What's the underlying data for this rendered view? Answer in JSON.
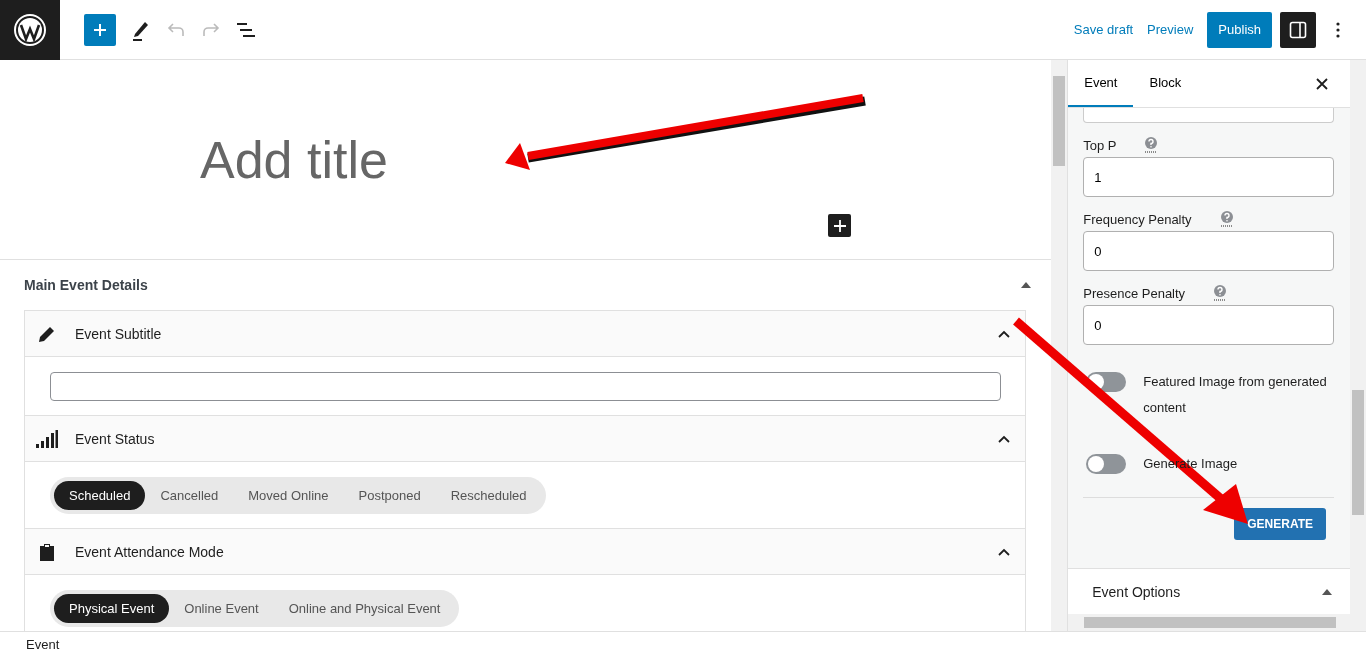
{
  "header": {
    "inserter_open": false,
    "undo_disabled": true,
    "redo_disabled": true,
    "actions": [
      {
        "label": "Save draft",
        "kind": "link"
      },
      {
        "label": "Preview",
        "kind": "link"
      },
      {
        "label": "Publish",
        "kind": "primary"
      }
    ],
    "settings_open": true
  },
  "editor": {
    "title_placeholder": "Add title"
  },
  "meta_box": {
    "title": "Main Event Details",
    "expanded": true,
    "sections": [
      {
        "title": "Event Subtitle",
        "kind": "text",
        "expanded": true
      },
      {
        "title": "Event Status",
        "kind": "choice",
        "expanded": true,
        "options": [
          {
            "label": "Scheduled",
            "selected": true
          },
          {
            "label": "Cancelled",
            "selected": false
          },
          {
            "label": "Moved Online",
            "selected": false
          },
          {
            "label": "Postponed",
            "selected": false
          },
          {
            "label": "Rescheduled",
            "selected": false
          }
        ]
      },
      {
        "title": "Event Attendance Mode",
        "kind": "choice",
        "expanded": true,
        "options": [
          {
            "label": "Physical Event",
            "selected": true
          },
          {
            "label": "Online Event",
            "selected": false
          },
          {
            "label": "Online and Physical Event",
            "selected": false
          }
        ]
      }
    ]
  },
  "sidebar": {
    "tabs": [
      {
        "label": "Event",
        "selected": true
      },
      {
        "label": "Block",
        "selected": false
      }
    ],
    "fields": [
      {
        "label": "Top P",
        "value": "1"
      },
      {
        "label": "Frequency Penalty",
        "value": "0"
      },
      {
        "label": "Presence Penalty",
        "value": "0"
      }
    ],
    "toggles": [
      {
        "label": "Featured Image from generated content",
        "on": false
      },
      {
        "label": "Generate Image",
        "on": false
      }
    ],
    "button": "GENERATE",
    "panel": {
      "title": "Event Options",
      "expanded": true
    }
  },
  "status_bar": {
    "breadcrumb": "Event"
  }
}
